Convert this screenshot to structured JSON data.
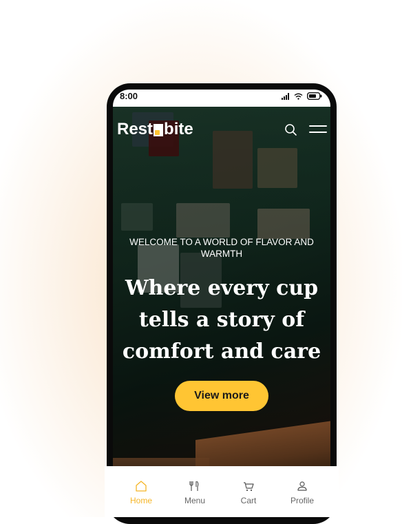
{
  "status_bar": {
    "time": "8:00",
    "icons": [
      "signal-icon",
      "wifi-icon",
      "battery-icon"
    ]
  },
  "header": {
    "brand_prefix": "Rest",
    "brand_suffix": "bite",
    "icons": [
      "search-icon",
      "menu-icon"
    ]
  },
  "hero": {
    "welcome_line1": "WELCOME TO A WORLD OF FLAVOR AND",
    "welcome_line2": "WARMTH",
    "headline_line1": "Where every cup",
    "headline_line2": "tells a story of",
    "headline_line3": "comfort and care",
    "cta_label": "View more"
  },
  "tabbar": {
    "active": "Home",
    "items": [
      {
        "label": "Home",
        "icon": "home-icon"
      },
      {
        "label": "Menu",
        "icon": "fork-knife-icon"
      },
      {
        "label": "Cart",
        "icon": "cart-icon"
      },
      {
        "label": "Profile",
        "icon": "profile-icon"
      }
    ]
  },
  "colors": {
    "accent": "#ffc533",
    "active_tab": "#f5b526",
    "text_light": "#ffffff",
    "tab_inactive": "#666666"
  }
}
